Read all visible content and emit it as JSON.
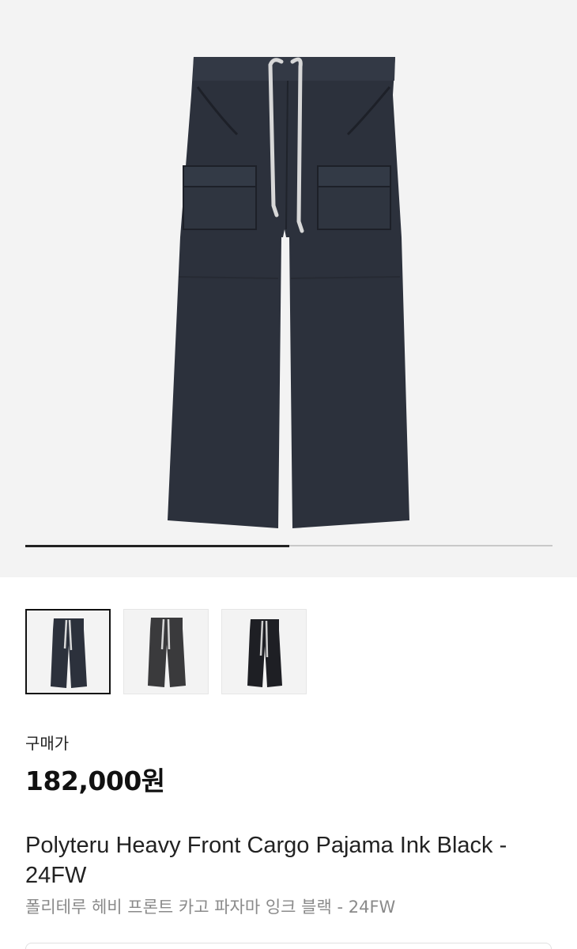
{
  "gallery": {
    "main_image": "product-photo-pants",
    "image_count": 3,
    "active_index": 1,
    "progress_fraction": 0.5,
    "thumbnails": [
      {
        "image": "pants-front-ink-black",
        "active": true
      },
      {
        "image": "pants-front-dark-grey",
        "active": false
      },
      {
        "image": "pants-front-black-model",
        "active": false
      }
    ]
  },
  "price": {
    "label": "구매가",
    "value": "182,000원"
  },
  "product": {
    "title": "Polyteru Heavy Front Cargo Pajama Ink Black - 24FW",
    "subtitle": "폴리테루 헤비 프론트 카고 파자마 잉크 블랙 - 24FW"
  },
  "colors": {
    "hero_bg": "#f3f3f3",
    "pants": "#2c313c",
    "drawstring": "#d8d8d8",
    "progress_active": "#222222",
    "subtitle_text": "#8a8a8a"
  }
}
